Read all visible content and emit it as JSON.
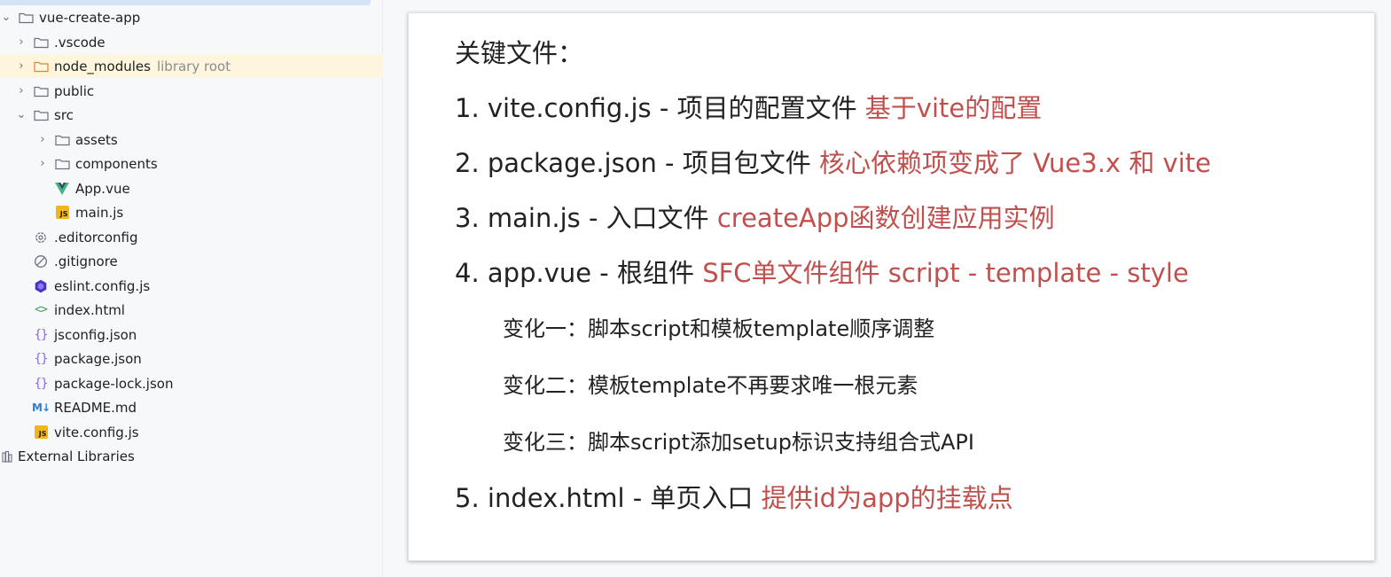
{
  "tree": {
    "items": [
      {
        "label": "vue-create-app",
        "depth": 0,
        "expanded": true,
        "icon": "folder-icon"
      },
      {
        "label": ".vscode",
        "depth": 1,
        "expanded": false,
        "icon": "folder-icon"
      },
      {
        "label": "node_modules",
        "hint": "library root",
        "depth": 1,
        "expanded": false,
        "icon": "folder-icon",
        "highlight": true
      },
      {
        "label": "public",
        "depth": 1,
        "expanded": false,
        "icon": "folder-icon"
      },
      {
        "label": "src",
        "depth": 1,
        "expanded": true,
        "icon": "folder-icon"
      },
      {
        "label": "assets",
        "depth": 2,
        "expanded": false,
        "icon": "folder-icon"
      },
      {
        "label": "components",
        "depth": 2,
        "expanded": false,
        "icon": "folder-icon"
      },
      {
        "label": "App.vue",
        "depth": 2,
        "icon": "vue-icon"
      },
      {
        "label": "main.js",
        "depth": 2,
        "icon": "js-file-icon"
      },
      {
        "label": ".editorconfig",
        "depth": 1,
        "icon": "gear-icon"
      },
      {
        "label": ".gitignore",
        "depth": 1,
        "icon": "ignore-icon"
      },
      {
        "label": "eslint.config.js",
        "depth": 1,
        "icon": "eslint-icon"
      },
      {
        "label": "index.html",
        "depth": 1,
        "icon": "html-icon"
      },
      {
        "label": "jsconfig.json",
        "depth": 1,
        "icon": "json-icon"
      },
      {
        "label": "package.json",
        "depth": 1,
        "icon": "json-icon"
      },
      {
        "label": "package-lock.json",
        "depth": 1,
        "icon": "json-icon"
      },
      {
        "label": "README.md",
        "depth": 1,
        "icon": "markdown-icon"
      },
      {
        "label": "vite.config.js",
        "depth": 1,
        "icon": "js-file-icon"
      },
      {
        "label": "External Libraries",
        "depth": -1,
        "icon": "library-icon"
      }
    ]
  },
  "icons": {
    "js_text": "JS",
    "md_text": "M↓",
    "json_text": "{}",
    "html_text": "<>"
  },
  "slide": {
    "title": "关键文件：",
    "lines": [
      {
        "text": "1. vite.config.js - 项目的配置文件 ",
        "note": "基于vite的配置"
      },
      {
        "text": "2. package.json - 项目包文件 ",
        "note": "核心依赖项变成了 Vue3.x 和 vite"
      },
      {
        "text": "3. main.js - 入口文件 ",
        "note": "createApp函数创建应用实例"
      },
      {
        "text": "4. app.vue - 根组件 ",
        "note": "SFC单文件组件 script - template - style"
      }
    ],
    "changes": [
      "变化一：脚本script和模板template顺序调整",
      "变化二：模板template不再要求唯一根元素",
      "变化三：脚本script添加setup标识支持组合式API"
    ],
    "last": {
      "text": "5. index.html - 单页入口 ",
      "note": "提供id为app的挂载点"
    }
  },
  "colors": {
    "accent_red": "#c0504d",
    "highlight_row": "#fdf5dc",
    "folder_stroke": "#6c707e",
    "vue_green": "#41b883",
    "eslint_purple": "#4b32c3"
  }
}
